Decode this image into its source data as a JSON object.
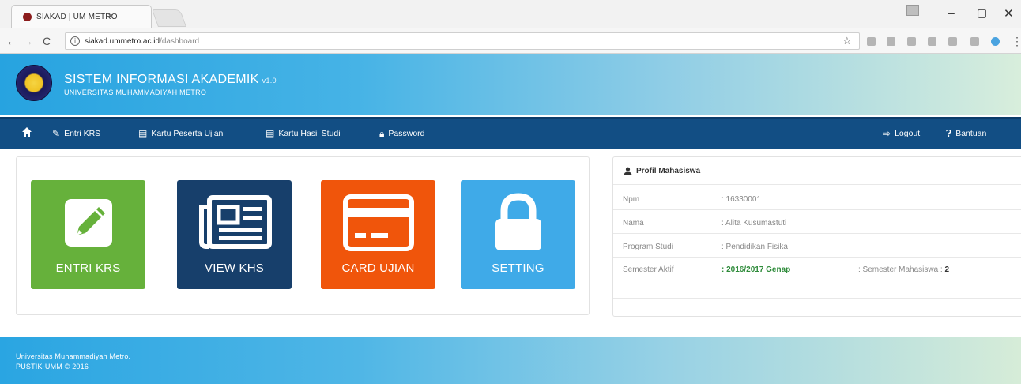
{
  "browser": {
    "tab_title": "SIAKAD | UM METRO",
    "tab_close": "×",
    "url_host": "siakad.ummetro.ac.id",
    "url_path": "/dashboard",
    "controls": {
      "minimize": "–",
      "maximize": "▢",
      "close": "✕"
    }
  },
  "header": {
    "title": "SISTEM INFORMASI AKADEMIK",
    "version": "v1.0",
    "subtitle": "UNIVERSITAS MUHAMMADIYAH METRO"
  },
  "nav": {
    "items": [
      {
        "label": "Entri KRS",
        "icon": "edit-icon"
      },
      {
        "label": "Kartu Peserta Ujian",
        "icon": "list-icon"
      },
      {
        "label": "Kartu Hasil Studi",
        "icon": "list-icon"
      },
      {
        "label": "Password",
        "icon": "lock-icon"
      }
    ],
    "right_items": [
      {
        "label": "Logout",
        "icon": "logout-icon"
      },
      {
        "label": "Bantuan",
        "icon": "help-icon"
      }
    ]
  },
  "tiles": [
    {
      "label": "ENTRI KRS",
      "icon": "pencil-icon",
      "color": "#66b13b"
    },
    {
      "label": "VIEW KHS",
      "icon": "newspaper-icon",
      "color": "#173f6b"
    },
    {
      "label": "CARD UJIAN",
      "icon": "credit-card-icon",
      "color": "#f0550b"
    },
    {
      "label": "SETTING",
      "icon": "padlock-icon",
      "color": "#3faae8"
    }
  ],
  "profile": {
    "title": "Profil Mahasiswa",
    "rows": [
      {
        "label": "Npm",
        "value": ": 16330001"
      },
      {
        "label": "Nama",
        "value": ": Alita Kusumastuti"
      },
      {
        "label": "Program Studi",
        "value": ": Pendidikan Fisika"
      },
      {
        "label": "Semester Aktif",
        "value": ": 2016/2017 Genap"
      }
    ],
    "semester_mahasiswa_label": ": Semester Mahasiswa :",
    "semester_mahasiswa_value": "2"
  },
  "footer": {
    "line1": "Universitas Muhammadiyah Metro.",
    "line2": "PUSTIK-UMM © 2016"
  }
}
